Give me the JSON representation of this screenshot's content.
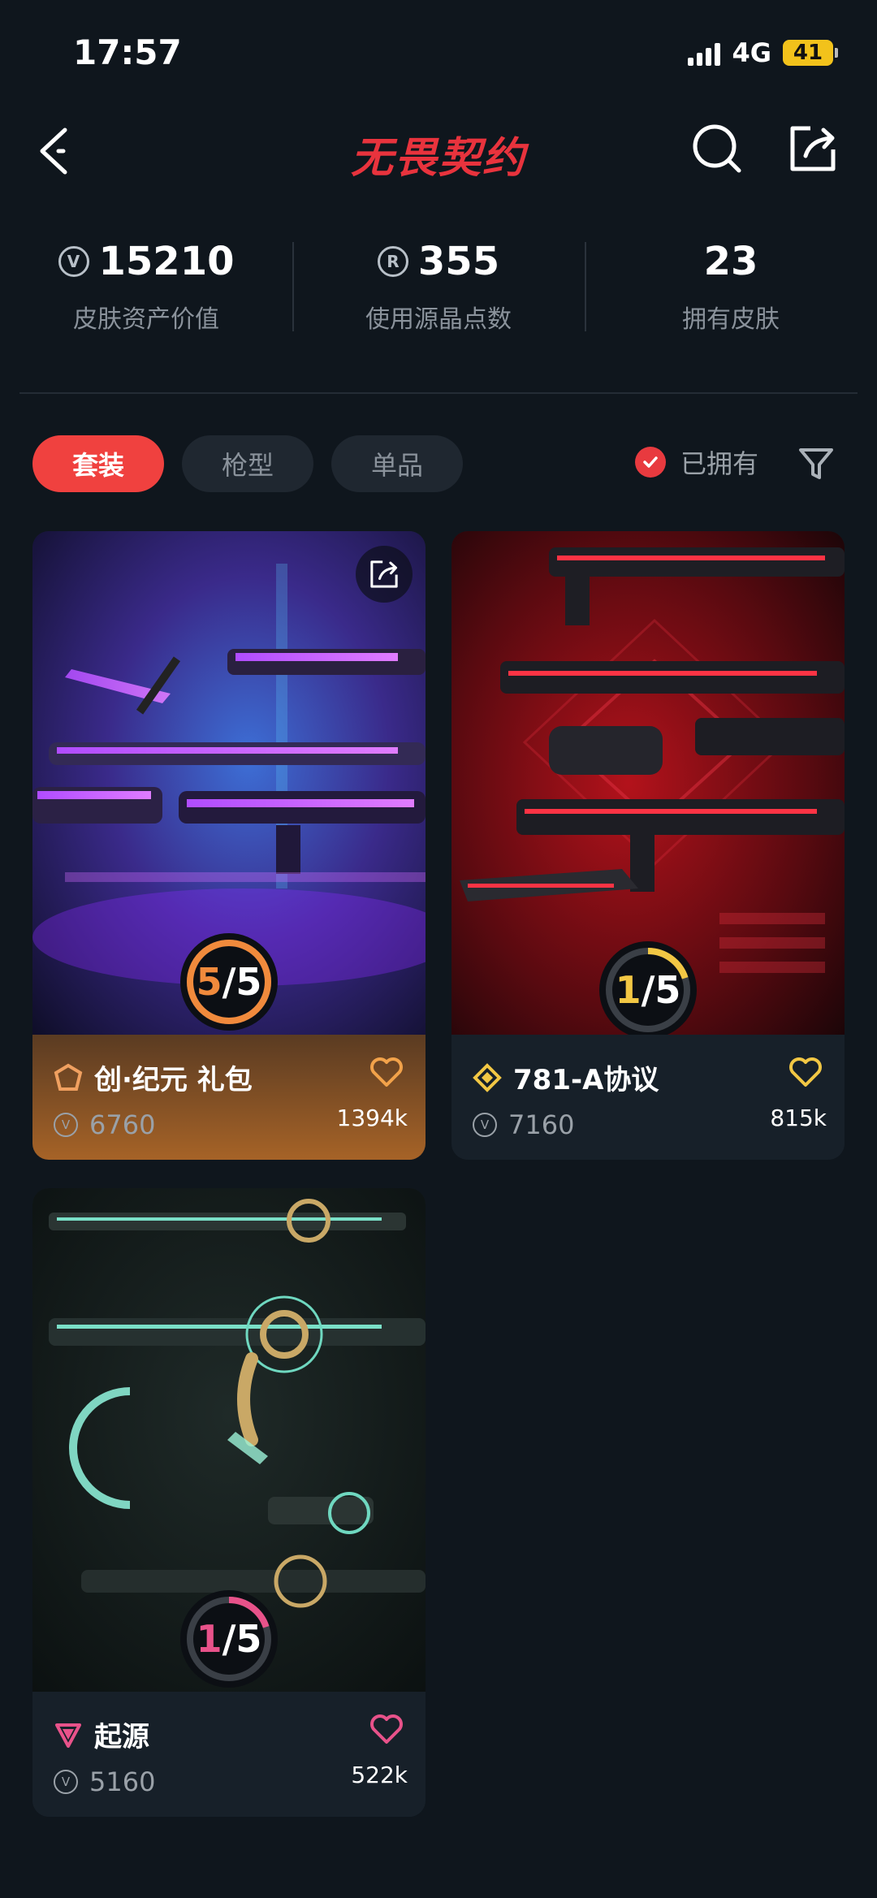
{
  "status_bar": {
    "time": "17:57",
    "network": "4G",
    "battery": "41"
  },
  "header": {
    "title": "无畏契约"
  },
  "stats": [
    {
      "value": "15210",
      "label": "皮肤资产价值",
      "icon": "vp-coin-icon"
    },
    {
      "value": "355",
      "label": "使用源晶点数",
      "icon": "radianite-icon"
    },
    {
      "value": "23",
      "label": "拥有皮肤",
      "icon": ""
    }
  ],
  "tabs": [
    {
      "label": "套装",
      "active": true
    },
    {
      "label": "枪型",
      "active": false
    },
    {
      "label": "单品",
      "active": false
    }
  ],
  "filter": {
    "owned_label": "已拥有",
    "owned_checked": true
  },
  "cards": [
    {
      "name": "创·纪元 礼包",
      "price": "6760",
      "likes": "1394k",
      "owned": "5",
      "total": "5",
      "progress": 1.0,
      "accent": "#f08a3c",
      "tier_icon": "exclusive-tier-icon"
    },
    {
      "name": "781-A协议",
      "price": "7160",
      "likes": "815k",
      "owned": "1",
      "total": "5",
      "progress": 0.2,
      "accent": "#f2c744",
      "tier_icon": "ultra-tier-icon"
    },
    {
      "name": "起源",
      "price": "5160",
      "likes": "522k",
      "owned": "1",
      "total": "5",
      "progress": 0.2,
      "accent": "#e8528a",
      "tier_icon": "premium-tier-icon"
    }
  ],
  "colors": {
    "background": "#0f161d",
    "accent_red": "#f0413f"
  }
}
